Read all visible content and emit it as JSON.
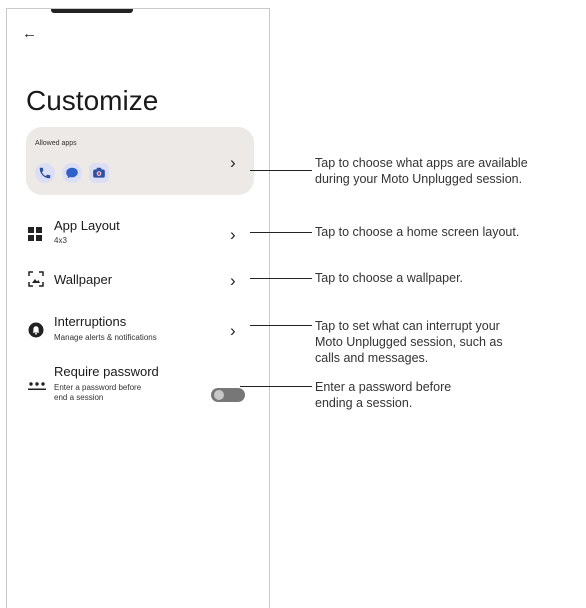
{
  "screen": {
    "title": "Customize",
    "back_icon": "arrow-left-icon",
    "allowed_apps": {
      "label": "Allowed apps",
      "apps": [
        "phone-icon",
        "messages-icon",
        "camera-icon"
      ]
    },
    "rows": [
      {
        "title": "App Layout",
        "subtitle": "4x3",
        "icon": "grid-icon"
      },
      {
        "title": "Wallpaper",
        "subtitle": "",
        "icon": "wallpaper-icon"
      },
      {
        "title": "Interruptions",
        "subtitle": "Manage alerts & notifications",
        "icon": "interruptions-icon"
      },
      {
        "title": "Require password",
        "subtitle_line1": "Enter a password before",
        "subtitle_line2": "end a session",
        "icon": "password-icon",
        "toggle_on": false
      }
    ]
  },
  "callouts": {
    "allowed_apps": [
      "Tap to choose what apps are available",
      "during your Moto Unplugged session."
    ],
    "app_layout": [
      "Tap to choose a home screen layout."
    ],
    "wallpaper": [
      "Tap to choose a wallpaper."
    ],
    "interruptions": [
      "Tap to set what can interrupt your",
      "Moto Unplugged session, such as",
      "calls and messages."
    ],
    "password": [
      "Enter a password before",
      "ending a session."
    ]
  },
  "colors": {
    "card_bg": "#ece9e6",
    "app_icon_bg": "#dcdff3",
    "app_icon_fg": "#2f4fa2",
    "toggle_off": "#777777"
  }
}
